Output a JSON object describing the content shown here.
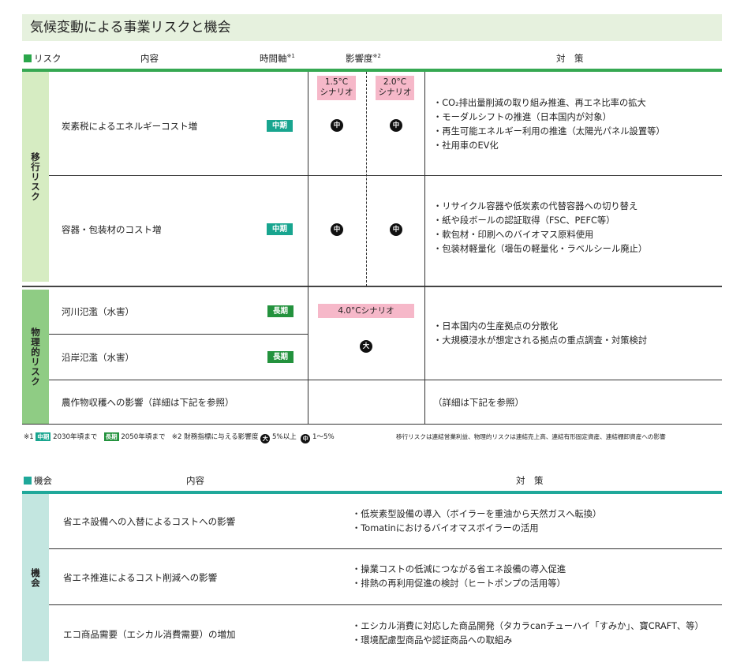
{
  "title": "気候変動による事業リスクと機会",
  "risk_header": {
    "section": "リスク",
    "content": "内容",
    "timeline": "時間軸",
    "timeline_note": "※1",
    "impact": "影響度",
    "impact_note": "※2",
    "measures": "対　策"
  },
  "transition": {
    "label": "移行リスク",
    "scenario_15": [
      "1.5°C",
      "シナリオ"
    ],
    "scenario_20": [
      "2.0°C",
      "シナリオ"
    ],
    "rows": [
      {
        "content": "炭素税によるエネルギーコスト増",
        "timeline": "中期",
        "impact_15": "中",
        "impact_20": "中",
        "measures": [
          "・CO₂排出量削減の取り組み推進、再エネ比率の拡大",
          "・モーダルシフトの推進（日本国内が対象）",
          "・再生可能エネルギー利用の推進（太陽光パネル設置等）",
          "・社用車のEV化"
        ]
      },
      {
        "content": "容器・包装材のコスト増",
        "timeline": "中期",
        "impact_15": "中",
        "impact_20": "中",
        "measures": [
          "・リサイクル容器や低炭素の代替容器への切り替え",
          "・紙や段ボールの認証取得（FSC、PEFC等）",
          "・軟包材・印刷へのバイオマス原料使用",
          "・包装材軽量化（壜缶の軽量化・ラベルシール廃止）"
        ]
      }
    ]
  },
  "physical": {
    "label": "物理的リスク",
    "scenario_40": "4.0°Cシナリオ",
    "impact": "大",
    "rows": [
      {
        "content": "河川氾濫（水害）",
        "timeline": "長期"
      },
      {
        "content": "沿岸氾濫（水害）",
        "timeline": "長期"
      },
      {
        "content": "農作物収穫への影響（詳細は下記を参照）"
      }
    ],
    "measures": [
      "・日本国内の生産拠点の分散化",
      "・大規模浸水が想定される拠点の重点調査・対策検討"
    ],
    "agri_measures": "（詳細は下記を参照）"
  },
  "notes": {
    "n1": "※1",
    "mid_badge": "中期",
    "mid_text": "2030年頃まで",
    "long_badge": "長期",
    "long_text": "2050年頃まで",
    "n2": "※2 財務指標に与える影響度",
    "big": "大",
    "big_text": "5%以上",
    "mid": "中",
    "mid_range": "1〜5%",
    "footnote": "移行リスクは連結営業利益、物理的リスクは連結売上高、連結有形固定資産、連結棚卸資産への影響"
  },
  "opportunity": {
    "section": "機会",
    "content": "内容",
    "measures": "対　策",
    "label": "機会",
    "rows": [
      {
        "content": "省エネ設備への入替によるコストへの影響",
        "measures": [
          "・低炭素型設備の導入（ボイラーを重油から天然ガスへ転換）",
          "・Tomatinにおけるバイオマスボイラーの活用"
        ]
      },
      {
        "content": "省エネ推進によるコスト削減への影響",
        "measures": [
          "・操業コストの低減につながる省エネ設備の導入促進",
          "・排熱の再利用促進の検討（ヒートポンプの活用等）"
        ]
      },
      {
        "content": "エコ商品需要（エシカル消費需要）の増加",
        "measures": [
          "・エシカル消費に対応した商品開発（タカラcanチューハイ「すみか」、寶CRAFT、等）",
          "・環境配慮型商品や認証商品への取組み"
        ]
      }
    ]
  },
  "colors": {
    "title_bg": "#e6f1de",
    "transition_bg": "#d6ecc2",
    "physical_bg": "#8fcc84",
    "opportunity_bg": "#c3e6e0",
    "green_line": "#36a852",
    "teal_line": "#1fa89a",
    "scenario_pink": "#f6b8c9"
  }
}
